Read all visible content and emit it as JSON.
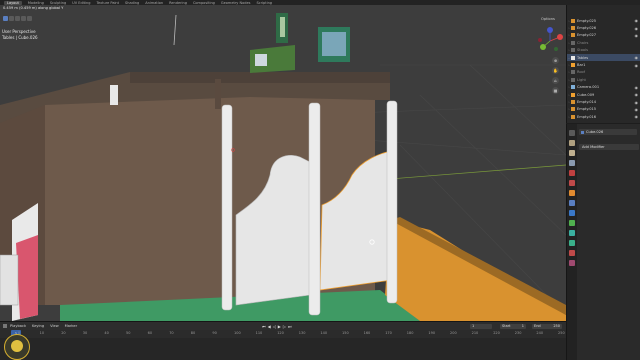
{
  "topbar": {
    "tabs": [
      "Layout",
      "Modeling",
      "Sculpting",
      "UV Editing",
      "Texture Paint",
      "Shading",
      "Animation",
      "Rendering",
      "Compositing",
      "Geometry Nodes",
      "Scripting"
    ],
    "active": "Layout"
  },
  "viewport": {
    "info_line1": "User Perspective",
    "info_line2": "Tables | Cube.026",
    "top_info": "0.459 m (0.459 m) along global Y",
    "options_label": "Options"
  },
  "gizmo": {
    "x": "X",
    "y": "Y",
    "z": "Z"
  },
  "outliner": {
    "rows": [
      {
        "label": "Empty.025",
        "icon": "empty-icon",
        "dim": false
      },
      {
        "label": "Empty.026",
        "icon": "empty-icon",
        "dim": false
      },
      {
        "label": "Empty.027",
        "icon": "empty-icon",
        "dim": false
      },
      {
        "label": "Chairs",
        "icon": "collection-icon",
        "dim": true
      },
      {
        "label": "Stools",
        "icon": "collection-icon",
        "dim": true
      },
      {
        "label": "Tables",
        "icon": "collection-icon",
        "dim": false
      },
      {
        "label": "Bar1",
        "icon": "mesh-icon",
        "dim": false
      },
      {
        "label": "Roof",
        "icon": "collection-icon",
        "dim": true
      },
      {
        "label": "Light",
        "icon": "collection-icon",
        "dim": true
      },
      {
        "label": "Camera.001",
        "icon": "camera-icon",
        "dim": false
      },
      {
        "label": "Cube.009",
        "icon": "mesh-icon",
        "dim": false
      },
      {
        "label": "Empty.014",
        "icon": "empty-icon",
        "dim": false
      },
      {
        "label": "Empty.015",
        "icon": "empty-icon",
        "dim": false
      },
      {
        "label": "Empty.016",
        "icon": "empty-icon",
        "dim": false
      }
    ]
  },
  "properties": {
    "object_name": "Cube.026",
    "add_modifier": "Add Modifier"
  },
  "timeline": {
    "menus": [
      "Playback",
      "Keying",
      "View",
      "Marker"
    ],
    "current_frame": "1",
    "start_label": "Start",
    "start_value": "1",
    "end_label": "End",
    "end_value": "250",
    "ticks": [
      "0",
      "10",
      "20",
      "30",
      "40",
      "50",
      "60",
      "70",
      "80",
      "90",
      "100",
      "110",
      "120",
      "130",
      "140",
      "150",
      "160",
      "170",
      "180",
      "190",
      "200",
      "210",
      "220",
      "230",
      "240",
      "250"
    ]
  },
  "colors": {
    "viewport_bg": "#3d3d3d",
    "wall_brown": "#6e5a4b",
    "floor_green": "#3f9a64",
    "floor_orange": "#d9922f",
    "door_white": "#e6e6e6",
    "accent_blue": "#5a7fc1",
    "selected_orange": "#f0a030"
  }
}
